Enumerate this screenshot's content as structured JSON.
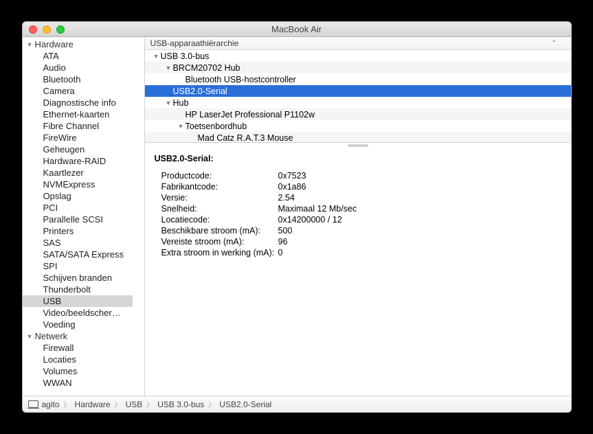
{
  "window": {
    "title": "MacBook Air"
  },
  "sidebar": {
    "categories": [
      {
        "label": "Hardware",
        "items": [
          "ATA",
          "Audio",
          "Bluetooth",
          "Camera",
          "Diagnostische info",
          "Ethernet-kaarten",
          "Fibre Channel",
          "FireWire",
          "Geheugen",
          "Hardware-RAID",
          "Kaartlezer",
          "NVMExpress",
          "Opslag",
          "PCI",
          "Parallelle SCSI",
          "Printers",
          "SAS",
          "SATA/SATA Express",
          "SPI",
          "Schijven branden",
          "Thunderbolt",
          "USB",
          "Video/beeldscher…",
          "Voeding"
        ],
        "selected": "USB"
      },
      {
        "label": "Netwerk",
        "items": [
          "Firewall",
          "Locaties",
          "Volumes",
          "WWAN"
        ]
      }
    ]
  },
  "tree": {
    "header": "USB-apparaathiërarchie",
    "rows": [
      {
        "depth": 0,
        "label": "USB 3.0-bus",
        "expandable": true
      },
      {
        "depth": 1,
        "label": "BRCM20702 Hub",
        "expandable": true
      },
      {
        "depth": 2,
        "label": "Bluetooth USB-hostcontroller",
        "expandable": false
      },
      {
        "depth": 1,
        "label": "USB2.0-Serial",
        "expandable": false,
        "selected": true
      },
      {
        "depth": 1,
        "label": "Hub",
        "expandable": true
      },
      {
        "depth": 2,
        "label": "HP LaserJet Professional P1102w",
        "expandable": false
      },
      {
        "depth": 2,
        "label": "Toetsenbordhub",
        "expandable": true
      },
      {
        "depth": 3,
        "label": "Mad Catz R.A.T.3 Mouse",
        "expandable": false
      }
    ]
  },
  "details": {
    "title": "USB2.0-Serial:",
    "rows": [
      {
        "k": "Productcode:",
        "v": "0x7523"
      },
      {
        "k": "Fabrikantcode:",
        "v": "0x1a86"
      },
      {
        "k": "Versie:",
        "v": "2.54"
      },
      {
        "k": "Snelheid:",
        "v": "Maximaal 12 Mb/sec"
      },
      {
        "k": "Locatiecode:",
        "v": "0x14200000 / 12"
      },
      {
        "k": "Beschikbare stroom (mA):",
        "v": "500"
      },
      {
        "k": "Vereiste stroom (mA):",
        "v": "96"
      },
      {
        "k": "Extra stroom in werking (mA):",
        "v": "0"
      }
    ]
  },
  "breadcrumb": {
    "host": "agito",
    "parts": [
      "Hardware",
      "USB",
      "USB 3.0-bus",
      "USB2.0-Serial"
    ]
  }
}
